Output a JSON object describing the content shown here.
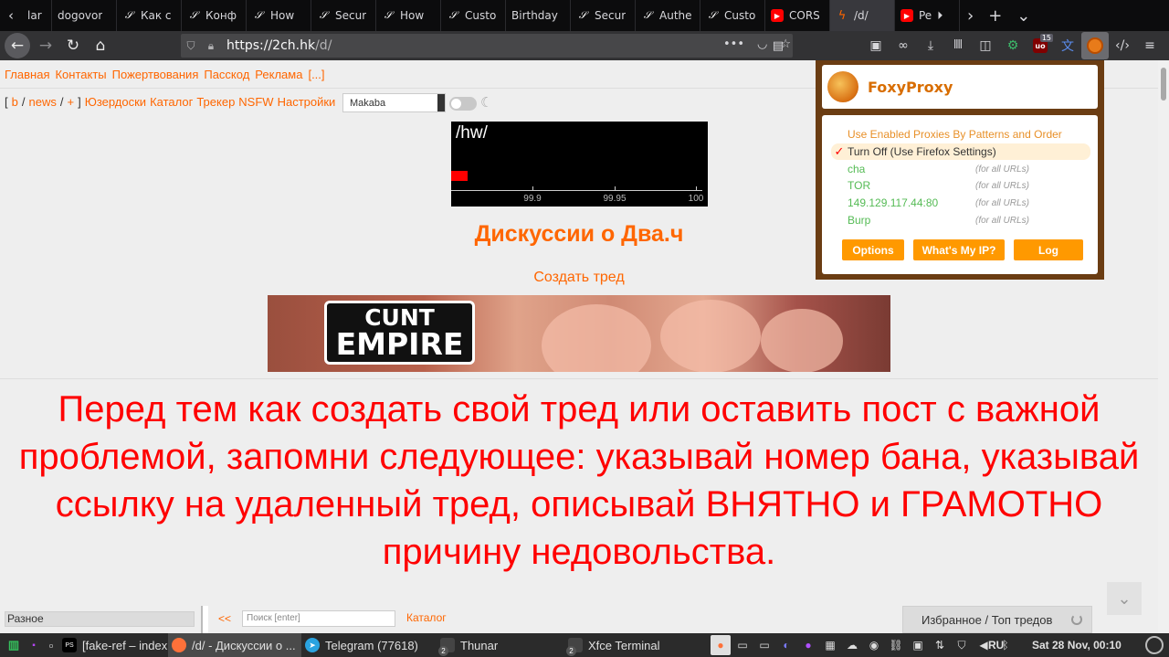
{
  "tabs": [
    {
      "label": "lar",
      "icon": "nav-icon",
      "kind": "first"
    },
    {
      "label": "dogovor",
      "icon": "none"
    },
    {
      "label": "Как с",
      "icon": "s"
    },
    {
      "label": "Конф",
      "icon": "s"
    },
    {
      "label": "How",
      "icon": "s"
    },
    {
      "label": "Secur",
      "icon": "s"
    },
    {
      "label": "How",
      "icon": "s"
    },
    {
      "label": "Custo",
      "icon": "s"
    },
    {
      "label": "Birthday",
      "icon": "none"
    },
    {
      "label": "Secur",
      "icon": "s"
    },
    {
      "label": "Authe",
      "icon": "s"
    },
    {
      "label": "Custo",
      "icon": "s"
    },
    {
      "label": "CORS",
      "icon": "yt"
    },
    {
      "label": "/d/",
      "icon": "dv",
      "active": true
    },
    {
      "label": "Pe",
      "icon": "yt"
    }
  ],
  "url": {
    "host": "https://2ch.hk",
    "path": "/d/"
  },
  "ublock_count": "15",
  "topnav": [
    "Главная",
    "Контакты",
    "Пожертвования",
    "Пасскод",
    "Реклама",
    "[...]"
  ],
  "boardnav": {
    "b": "b",
    "news": "news",
    "plus": "+",
    "links": [
      "Юзердоски",
      "Каталог",
      "Трекер",
      "NSFW",
      "Настройки"
    ]
  },
  "style_select": "Makaba",
  "hw_banner": {
    "title": "/hw/",
    "progress": {
      "value": 99.86,
      "min": 99.85,
      "max": 100
    },
    "ticks": [
      "99.9",
      "99.95",
      "100"
    ]
  },
  "board_title": "Дискуссии о Два.ч",
  "create_thread": "Создать тред",
  "ad": {
    "l1": "CUNT",
    "l2": "EMPIRE"
  },
  "warning": "Перед тем как создать свой тред или оставить пост с важной проблемой, запомни следующее: указывай номер бана, указывай ссылку на удаленный тред, описывай ВНЯТНО и ГРАМОТНО причину недовольства.",
  "bottombar": {
    "category": "Разное",
    "prev": "<<",
    "search_placeholder": "Поиск [enter]",
    "catalog": "Каталог",
    "favorites": "Избранное / Топ тредов"
  },
  "foxyproxy": {
    "title": "FoxyProxy",
    "modes": [
      {
        "name": "Use Enabled Proxies By Patterns and Order",
        "selected": false
      },
      {
        "name": "Turn Off (Use Firefox Settings)",
        "selected": true
      }
    ],
    "proxies": [
      {
        "name": "cha",
        "scope": "(for all URLs)"
      },
      {
        "name": "TOR",
        "scope": "(for all URLs)"
      },
      {
        "name": "149.129.117.44:80",
        "scope": "(for all URLs)"
      },
      {
        "name": "Burp",
        "scope": "(for all URLs)"
      }
    ],
    "buttons": [
      "Options",
      "What's My IP?",
      "Log"
    ]
  },
  "taskbar": {
    "tasks": [
      {
        "label": "[fake-ref – index.p...",
        "count": ""
      },
      {
        "label": "/d/ - Дискуссии о ...",
        "count": "",
        "active": true
      },
      {
        "label": "Telegram (77618)",
        "count": ""
      },
      {
        "label": "Thunar",
        "count": "2"
      },
      {
        "label": "Xfce Terminal",
        "count": "2"
      }
    ],
    "layout": "RU",
    "clock": "Sat 28 Nov, 00:10"
  }
}
